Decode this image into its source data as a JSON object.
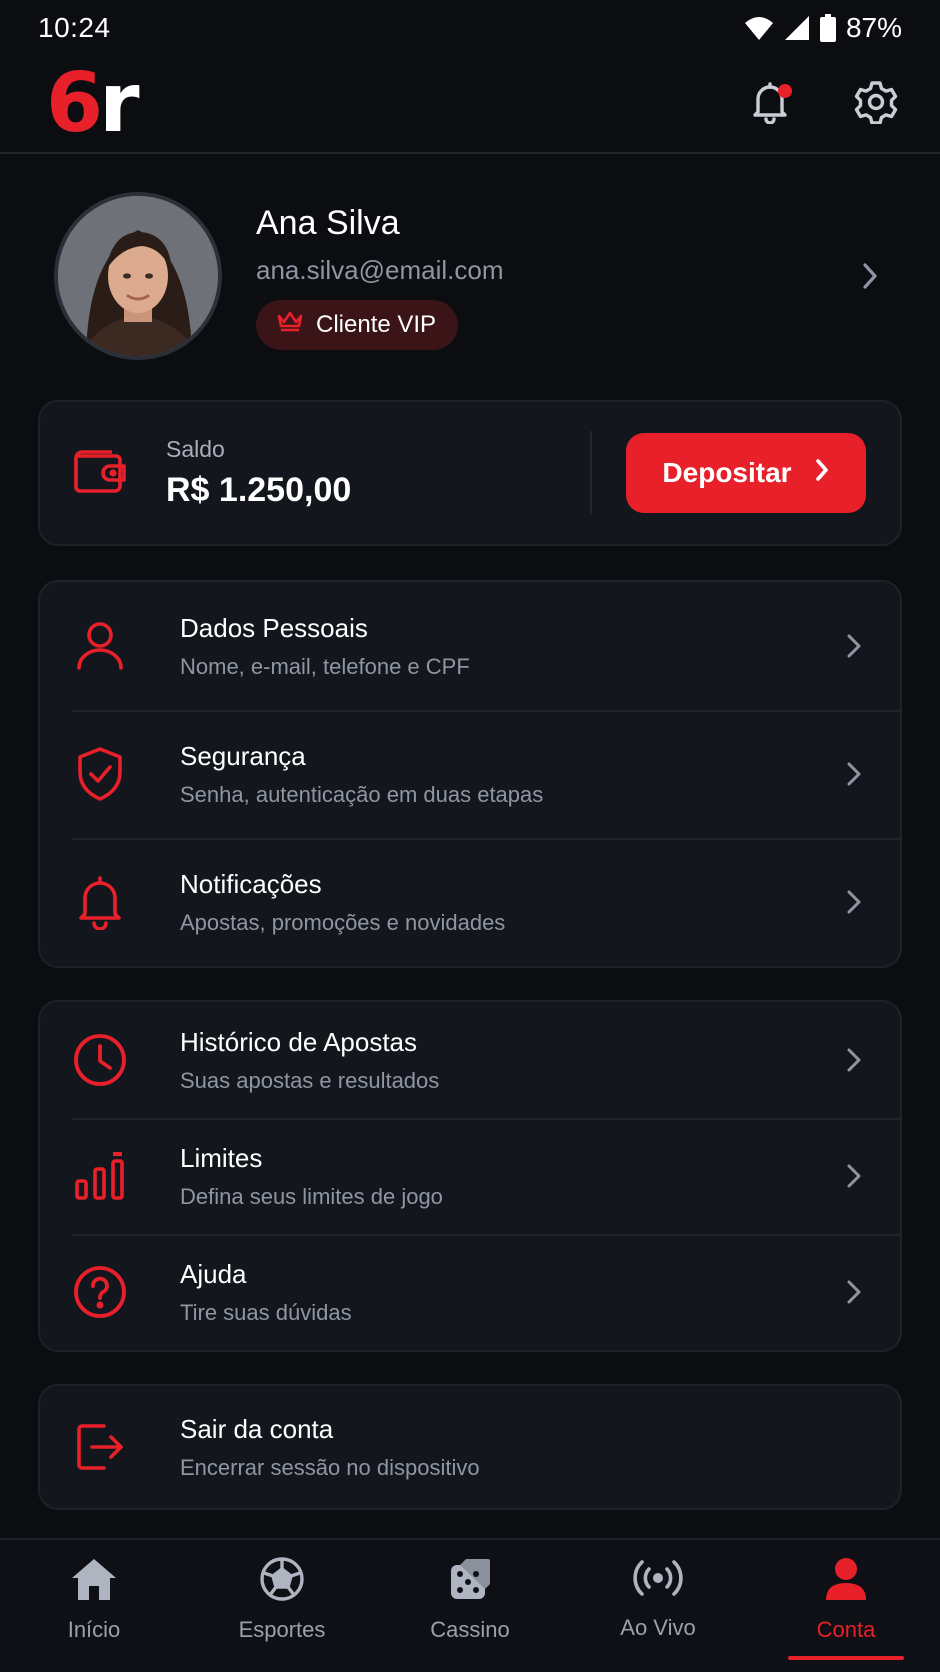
{
  "status_bar": {
    "time": "10:24",
    "battery": "87%",
    "icons": [
      "wifi-icon",
      "signal-icon",
      "battery-icon"
    ]
  },
  "header": {
    "logo_number": "6",
    "logo_letter": "r",
    "icons": [
      "bell-icon",
      "gear-icon"
    ],
    "has_notification": true
  },
  "profile": {
    "name": "Ana Silva",
    "email": "ana.silva@email.com",
    "badge": "Cliente VIP",
    "badge_icon": "crown-icon"
  },
  "balance": {
    "label": "Saldo",
    "value": "R$ 1.250,00",
    "icon": "wallet-icon",
    "deposit_label": "Depositar"
  },
  "menu_group_1": [
    {
      "title": "Dados Pessoais",
      "subtitle": "Nome, e-mail, telefone e CPF",
      "icon": "user-icon"
    },
    {
      "title": "Segurança",
      "subtitle": "Senha, autenticação em duas etapas",
      "icon": "shield-check-icon"
    },
    {
      "title": "Notificações",
      "subtitle": "Apostas, promoções e novidades",
      "icon": "bell-icon"
    }
  ],
  "menu_group_2": [
    {
      "title": "Histórico de Apostas",
      "subtitle": "Suas apostas e resultados",
      "icon": "clock-icon"
    },
    {
      "title": "Limites",
      "subtitle": "Defina seus limites de jogo",
      "icon": "bar-chart-icon"
    },
    {
      "title": "Ajuda",
      "subtitle": "Tire suas dúvidas",
      "icon": "help-circle-icon"
    }
  ],
  "logout": {
    "title": "Sair da conta",
    "subtitle": "Encerrar sessão no dispositivo",
    "icon": "logout-icon"
  },
  "bottom_nav": [
    {
      "label": "Início",
      "icon": "home-icon",
      "active": false
    },
    {
      "label": "Esportes",
      "icon": "soccer-ball-icon",
      "active": false
    },
    {
      "label": "Cassino",
      "icon": "dice-icon",
      "active": false
    },
    {
      "label": "Ao Vivo",
      "icon": "live-broadcast-icon",
      "active": false
    },
    {
      "label": "Conta",
      "icon": "user-icon",
      "active": true
    }
  ],
  "colors": {
    "accent": "#e8202a",
    "background": "#0b0d11",
    "card": "#13161c",
    "muted_text": "#8f96a3"
  }
}
